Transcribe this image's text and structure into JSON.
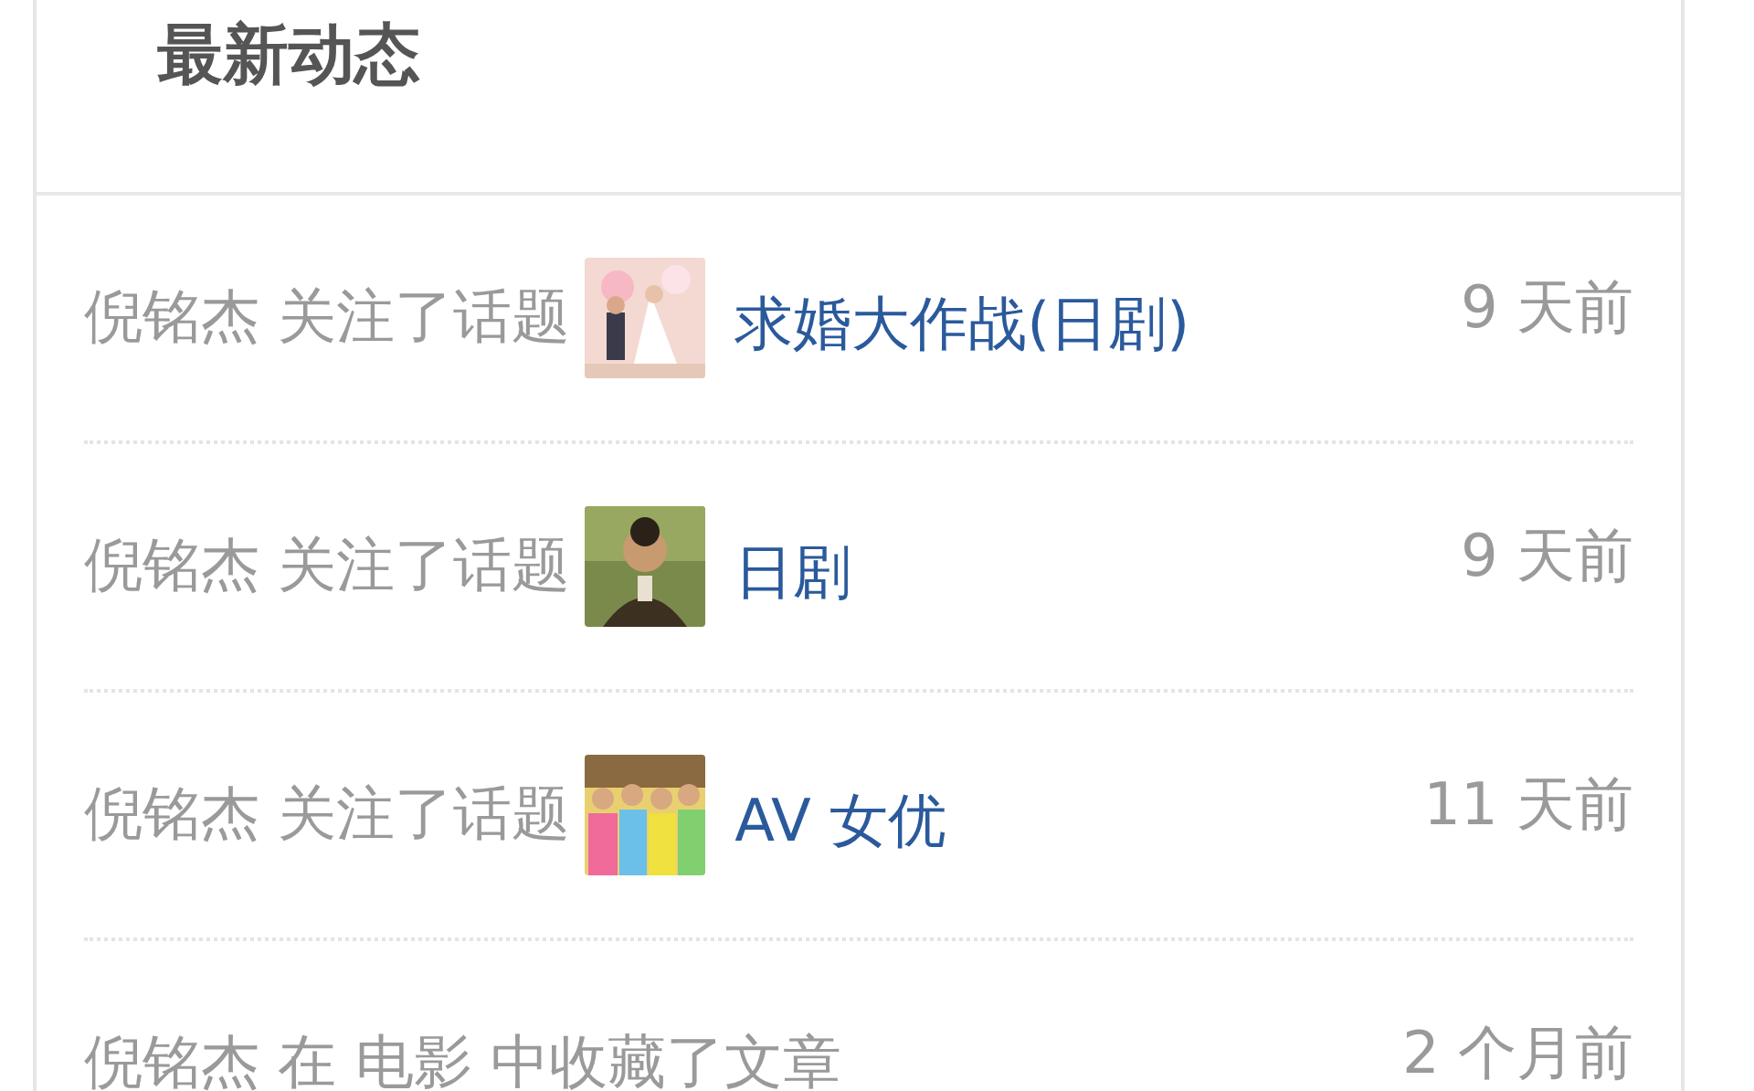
{
  "section": {
    "title": "最新动态"
  },
  "activities": [
    {
      "kind": "topic",
      "action": "倪铭杰 关注了话题",
      "topic": "求婚大作战(日剧)",
      "time": "9 天前"
    },
    {
      "kind": "topic",
      "action": "倪铭杰 关注了话题",
      "topic": "日剧",
      "time": "9 天前"
    },
    {
      "kind": "topic",
      "action": "倪铭杰 关注了话题",
      "topic": "AV 女优",
      "time": "11 天前"
    },
    {
      "kind": "text",
      "action": "倪铭杰 在 电影 中收藏了文章",
      "time": "2 个月前"
    }
  ]
}
